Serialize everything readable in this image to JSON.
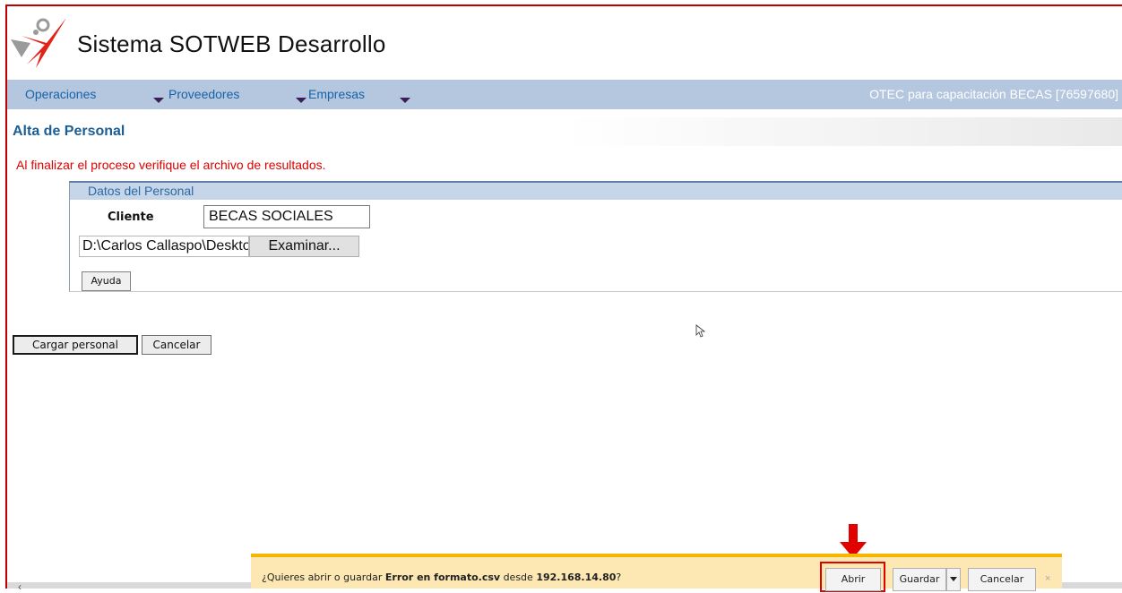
{
  "header": {
    "title": "Sistema SOTWEB Desarrollo"
  },
  "menu": {
    "items": [
      {
        "label": "Operaciones"
      },
      {
        "label": "Proveedores"
      },
      {
        "label": "Empresas"
      }
    ],
    "company": "OTEC para capacitación BECAS [76597680]"
  },
  "page": {
    "title": "Alta de Personal",
    "warning": "Al finalizar el proceso verifique el archivo de resultados."
  },
  "panel": {
    "legend": "Datos del Personal",
    "cliente_label": "Cliente",
    "cliente_value": "BECAS SOCIALES",
    "file_path": "D:\\Carlos Callaspo\\Desktop",
    "browse_label": "Examinar...",
    "help_label": "Ayuda"
  },
  "actions": {
    "load_label": "Cargar personal",
    "cancel_label": "Cancelar"
  },
  "download_bar": {
    "prefix": "¿Quieres abrir o guardar ",
    "filename": "Error en formato.csv",
    "middle": " desde ",
    "host": "192.168.14.80",
    "suffix": "?",
    "open_label": "Abrir",
    "save_label": "Guardar",
    "cancel_label": "Cancelar",
    "close_glyph": "×"
  },
  "colors": {
    "accent_red": "#e00000",
    "menu_bg": "#b4c7df",
    "link_blue": "#1763a6",
    "notify_bg": "#fde8b3"
  }
}
